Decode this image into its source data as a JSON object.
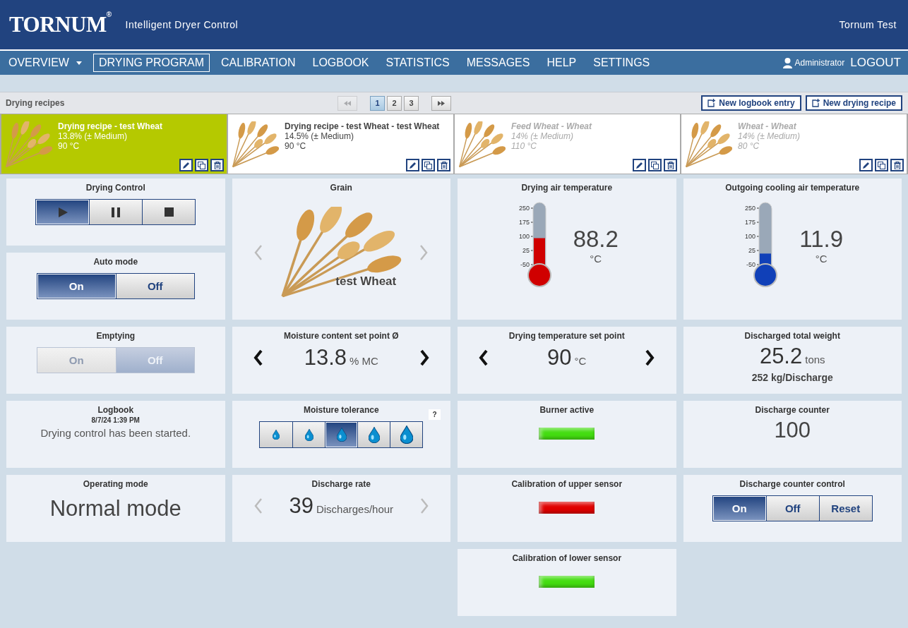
{
  "header": {
    "logo": "TORNUM$^{®}$",
    "subtitle": "Intelligent Dryer Control",
    "site": "Tornum Test"
  },
  "nav": {
    "items": [
      {
        "label": "OVERVIEW",
        "selected": false,
        "has_menu": true
      },
      {
        "label": "DRYING PROGRAM",
        "selected": true,
        "has_menu": false
      },
      {
        "label": "CALIBRATION",
        "selected": false,
        "has_menu": false
      },
      {
        "label": "LOGBOOK",
        "selected": false,
        "has_menu": false
      },
      {
        "label": "STATISTICS",
        "selected": false,
        "has_menu": false
      },
      {
        "label": "MESSAGES",
        "selected": false,
        "has_menu": false
      },
      {
        "label": "HELP",
        "selected": false,
        "has_menu": false
      },
      {
        "label": "SETTINGS",
        "selected": false,
        "has_menu": false
      }
    ],
    "user": "Administrator",
    "logout": "LOGOUT"
  },
  "recipes": {
    "title": "Drying recipes",
    "pagination": {
      "prev_enabled": false,
      "next_enabled": true,
      "pages": [
        {
          "label": "1",
          "selected": true
        },
        {
          "label": "2",
          "selected": false
        },
        {
          "label": "3",
          "selected": false
        }
      ]
    },
    "actions": [
      "New logbook entry",
      "New drying recipe"
    ],
    "cards": [
      {
        "title": "Drying recipe - test Wheat",
        "moisture": "13.8% (± Medium)",
        "temperature": "90 °C",
        "selected": true,
        "disabled": false
      },
      {
        "title": "Drying recipe - test Wheat - test Wheat",
        "moisture": "14.5% (± Medium)",
        "temperature": "90 °C",
        "selected": false,
        "disabled": false
      },
      {
        "title": "Feed Wheat - Wheat",
        "moisture": "14% (± Medium)",
        "temperature": "110 °C",
        "selected": false,
        "disabled": true
      },
      {
        "title": "Wheat - Wheat",
        "moisture": "14% (± Medium)",
        "temperature": "80 °C",
        "selected": false,
        "disabled": true
      }
    ]
  },
  "columns": [
    {
      "panels": [
        {
          "kind": "buttons",
          "title": "Drying Control",
          "disabled": false,
          "buttons": [
            {
              "selected": true
            },
            {
              "selected": false
            },
            {
              "selected": false
            }
          ]
        },
        {
          "kind": "buttons",
          "title": "Auto mode",
          "disabled": false,
          "buttons": [
            {
              "label": "On",
              "selected": true
            },
            {
              "label": "Off",
              "selected": false
            }
          ]
        },
        {
          "kind": "buttons",
          "title": "Emptying",
          "disabled": true,
          "buttons": [
            {
              "label": "On",
              "selected": false
            },
            {
              "label": "Off",
              "selected": true
            }
          ]
        },
        {
          "kind": "log",
          "title": "Logbook",
          "time": "8/7/24 1:39 PM",
          "message": "Drying control has been started."
        },
        {
          "kind": "text",
          "title": "Operating mode",
          "value": "Normal mode"
        }
      ]
    },
    {
      "panels": [
        {
          "kind": "grain",
          "title": "Grain",
          "name": "test Wheat",
          "arrows_enabled": false
        },
        {
          "kind": "stepper",
          "title": "Moisture content set point Ø",
          "value": "13.8",
          "unit": "% MC",
          "arrows_enabled": true
        },
        {
          "kind": "tolerance",
          "title": "Moisture tolerance",
          "help": "?",
          "drops": [
            {
              "selected": false
            },
            {
              "selected": false
            },
            {
              "selected": true
            },
            {
              "selected": false
            },
            {
              "selected": false
            }
          ]
        },
        {
          "kind": "stepper",
          "title": "Discharge rate",
          "value": "39",
          "unit": "Discharges/hour",
          "arrows_enabled": false
        }
      ]
    },
    {
      "panels": [
        {
          "kind": "thermometer",
          "title": "Drying air temperature",
          "ticks": [
            "250",
            "175",
            "100",
            "25",
            "-50"
          ],
          "level": 0.5,
          "color": "#d00000",
          "value": "88.2",
          "unit": "°C"
        },
        {
          "kind": "stepper",
          "title": "Drying temperature set point",
          "value": "90",
          "unit": "°C",
          "arrows_enabled": true
        },
        {
          "kind": "lamp",
          "title": "Burner active",
          "color": "#44dd11"
        },
        {
          "kind": "lamp",
          "title": "Calibration of upper sensor",
          "color": "#e00000"
        },
        {
          "kind": "lamp",
          "title": "Calibration of lower sensor",
          "color": "#44dd11"
        }
      ]
    },
    {
      "panels": [
        {
          "kind": "thermometer",
          "title": "Outgoing cooling air temperature",
          "ticks": [
            "250",
            "175",
            "100",
            "25",
            "-50"
          ],
          "level": 0.27,
          "color": "#1040b8",
          "value": "11.9",
          "unit": "°C"
        },
        {
          "kind": "weight",
          "title": "Discharged total weight",
          "value": "25.2",
          "unit": "tons",
          "detail": "252 kg/Discharge"
        },
        {
          "kind": "counter",
          "title": "Discharge counter",
          "value": "100"
        },
        {
          "kind": "buttons",
          "title": "Discharge counter control",
          "disabled": false,
          "buttons": [
            {
              "label": "On",
              "selected": true
            },
            {
              "label": "Off",
              "selected": false
            },
            {
              "label": "Reset",
              "selected": false
            }
          ]
        }
      ]
    }
  ]
}
